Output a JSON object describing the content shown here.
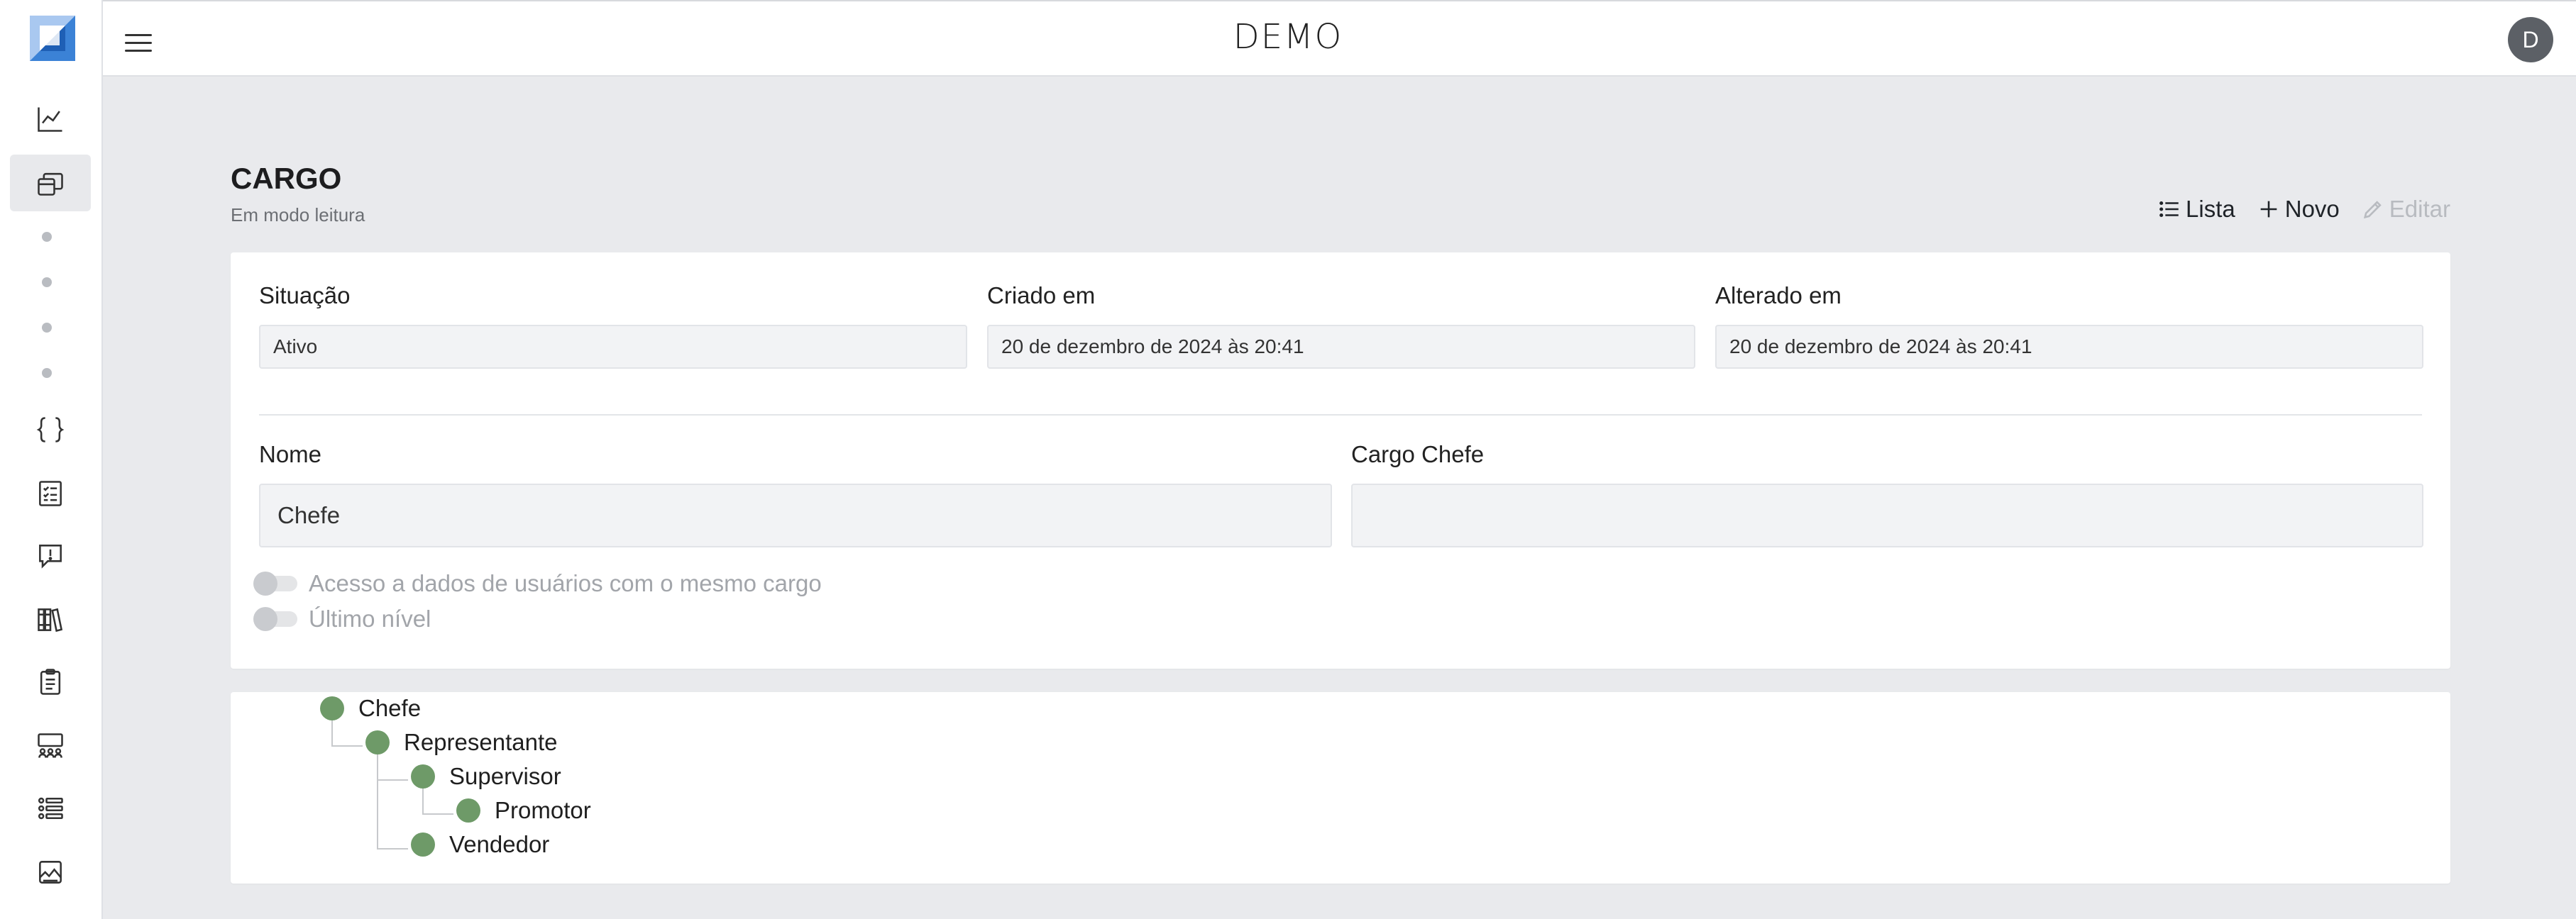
{
  "app": {
    "brand": "DEMO",
    "user_initial": "D"
  },
  "sidebar": {
    "items": [
      {
        "icon": "line-chart-icon"
      },
      {
        "icon": "layers-icon",
        "active": true
      },
      {
        "icon": "braces-icon"
      },
      {
        "icon": "checklist-icon"
      },
      {
        "icon": "alert-message-icon"
      },
      {
        "icon": "library-icon"
      },
      {
        "icon": "clipboard-icon"
      },
      {
        "icon": "team-icon"
      },
      {
        "icon": "user-list-icon"
      },
      {
        "icon": "image-icon"
      }
    ]
  },
  "page": {
    "title": "CARGO",
    "subtitle": "Em modo leitura",
    "actions": {
      "list": "Lista",
      "new": "Novo",
      "edit": "Editar"
    }
  },
  "form": {
    "situacao_label": "Situação",
    "situacao_value": "Ativo",
    "criado_label": "Criado em",
    "criado_value": "20 de dezembro de 2024 às 20:41",
    "alterado_label": "Alterado em",
    "alterado_value": "20 de dezembro de 2024 às 20:41",
    "nome_label": "Nome",
    "nome_value": "Chefe",
    "cargo_chefe_label": "Cargo Chefe",
    "cargo_chefe_value": "",
    "toggle_acesso": "Acesso a dados de usuários com o mesmo cargo",
    "toggle_ultimo": "Último nível"
  },
  "tree": {
    "nodes": [
      "Chefe",
      "Representante",
      "Supervisor",
      "Promotor",
      "Vendedor"
    ]
  },
  "colors": {
    "node": "#6e9a68",
    "background": "#e9eaed"
  }
}
